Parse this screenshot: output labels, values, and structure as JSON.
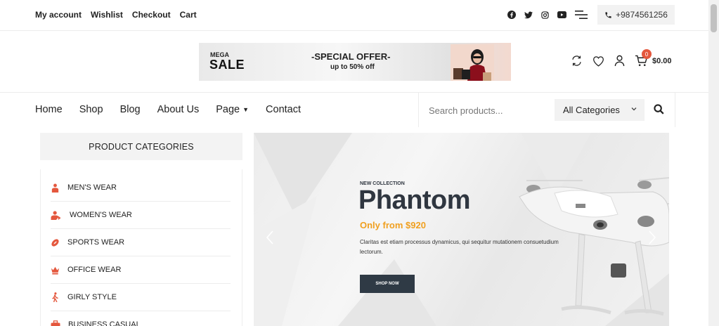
{
  "topbar": {
    "links": [
      "My account",
      "Wishlist",
      "Checkout",
      "Cart"
    ],
    "socials": [
      "facebook-icon",
      "twitter-icon",
      "instagram-icon",
      "youtube-icon",
      "menu-icon"
    ],
    "phone": "+9874561256"
  },
  "banner": {
    "mega": "MEGA",
    "sale": "SALE",
    "offer": "-SPECIAL OFFER-",
    "upto": "up to 50% off"
  },
  "header": {
    "cart_count": "0",
    "cart_total": "$0.00",
    "accent": "#e4573d"
  },
  "nav": {
    "items": [
      "Home",
      "Shop",
      "Blog",
      "About Us",
      "Page",
      "Contact"
    ]
  },
  "search": {
    "placeholder": "Search products...",
    "category": "All Categories"
  },
  "sidebar": {
    "heading": "PRODUCT CATEGORIES",
    "items": [
      {
        "label": "MEN'S WEAR",
        "icon": "man-icon"
      },
      {
        "label": "WOMEN'S WEAR",
        "icon": "women-icon"
      },
      {
        "label": "SPORTS WEAR",
        "icon": "football-icon"
      },
      {
        "label": "OFFICE WEAR",
        "icon": "crown-icon"
      },
      {
        "label": "GIRLY STYLE",
        "icon": "walking-icon"
      },
      {
        "label": "BUSINESS CASUAL",
        "icon": "briefcase-icon"
      }
    ]
  },
  "hero": {
    "eyebrow": "NEW COLLECTION",
    "title": "Phantom",
    "price": "Only from $920",
    "description": "Claritas est etiam processus dynamicus, qui sequitur mutationem consuetudium lectorum.",
    "button": "SHOP NOW",
    "price_color": "#f0a020"
  }
}
